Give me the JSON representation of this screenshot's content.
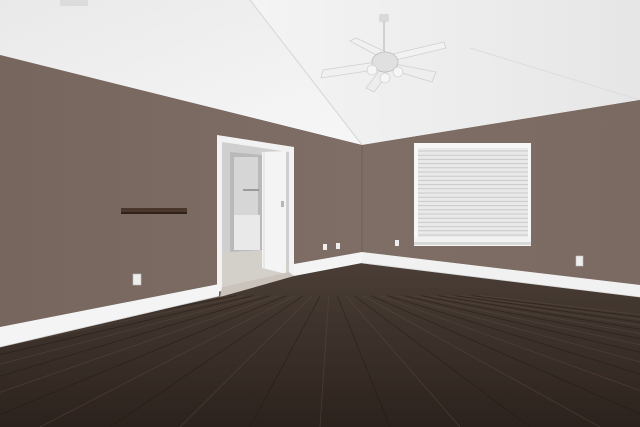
{
  "scene": {
    "room": "empty bedroom",
    "colors": {
      "wall": "#7a6a62",
      "wall_right": "#806f67",
      "ceiling": "#f1f1f1",
      "baseboard": "#f4f4f4",
      "floor": "#3b2f28",
      "window_blinds": "#ececec"
    },
    "objects": [
      "vaulted-ceiling",
      "ceiling-fan-icon",
      "window-with-blinds",
      "open-doorway-to-bathroom",
      "floating-wall-shelf",
      "wall-outlet-icon",
      "baseboard",
      "dark-wood-floor"
    ]
  }
}
